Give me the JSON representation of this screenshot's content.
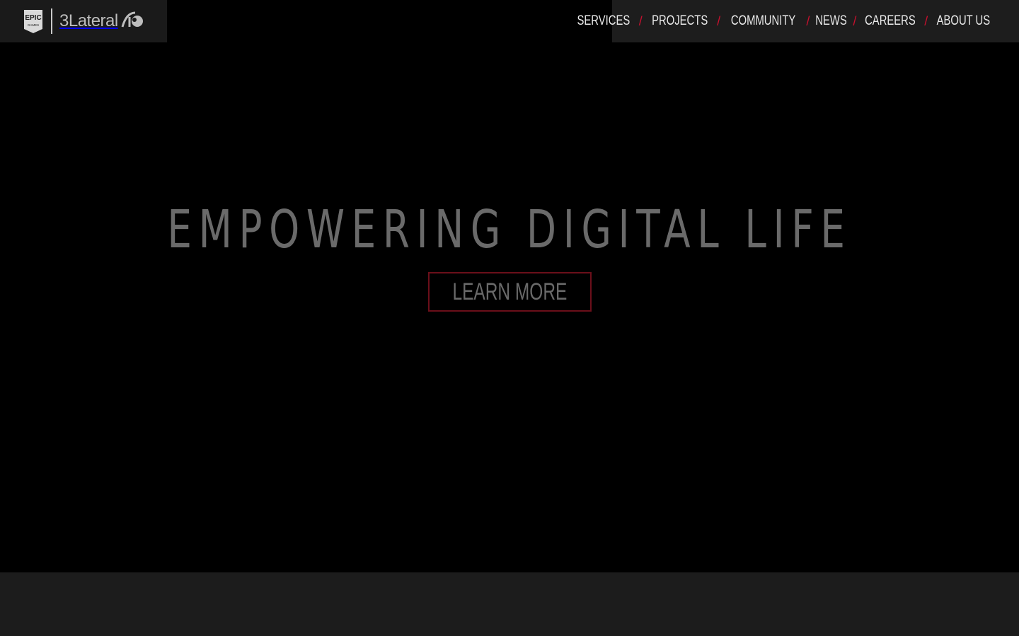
{
  "brand": {
    "epic_text": "EPIC",
    "epic_subtext": "GAMES",
    "name": "3Lateral"
  },
  "nav": {
    "items": [
      {
        "label": "SERVICES"
      },
      {
        "label": "PROJECTS"
      },
      {
        "label": "COMMUNITY"
      },
      {
        "label": "NEWS"
      },
      {
        "label": "CAREERS"
      },
      {
        "label": "ABOUT US"
      }
    ],
    "separator": "/"
  },
  "hero": {
    "title": "EMPOWERING DIGITAL LIFE",
    "cta_label": "LEARN MORE"
  },
  "colors": {
    "background": "#000000",
    "accent": "#c8102e",
    "nav_bg": "#1d1d1d",
    "title_text": "#6a6a6a"
  }
}
